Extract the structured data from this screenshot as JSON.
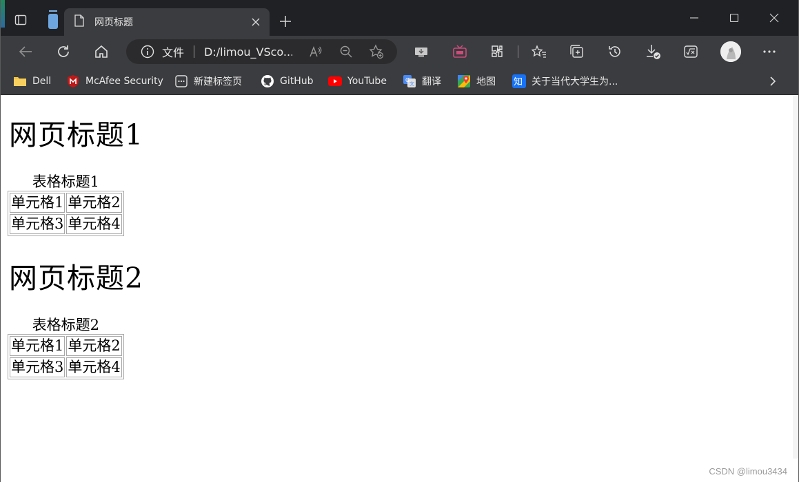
{
  "browser": {
    "tab": {
      "title": "网页标题"
    },
    "address": {
      "protocol_label": "文件",
      "url": "D:/limou_VSco..."
    },
    "bookmarks": [
      {
        "label": "Dell",
        "icon": "folder-icon"
      },
      {
        "label": "McAfee Security",
        "icon": "mcafee-shield-icon"
      },
      {
        "label": "新建标签页",
        "icon": "new-tab-page-icon"
      },
      {
        "label": "GitHub",
        "icon": "github-icon"
      },
      {
        "label": "YouTube",
        "icon": "youtube-icon"
      },
      {
        "label": "翻译",
        "icon": "translate-icon"
      },
      {
        "label": "地图",
        "icon": "maps-icon"
      },
      {
        "label": "关于当代大学生为...",
        "icon": "zhihu-icon"
      }
    ],
    "colors": {
      "titlebar": "#202124",
      "toolbar": "#3b3c3f",
      "youtube_red": "#ff0000",
      "zhihu_blue": "#1772f6",
      "mcafee_red": "#c01818"
    }
  },
  "page": {
    "sections": [
      {
        "heading": "网页标题1",
        "table": {
          "caption": "表格标题1",
          "rows": [
            [
              "单元格1",
              "单元格2"
            ],
            [
              "单元格3",
              "单元格4"
            ]
          ]
        }
      },
      {
        "heading": "网页标题2",
        "table": {
          "caption": "表格标题2",
          "rows": [
            [
              "单元格1",
              "单元格2"
            ],
            [
              "单元格3",
              "单元格4"
            ]
          ]
        }
      }
    ]
  },
  "watermark": "CSDN @limou3434"
}
